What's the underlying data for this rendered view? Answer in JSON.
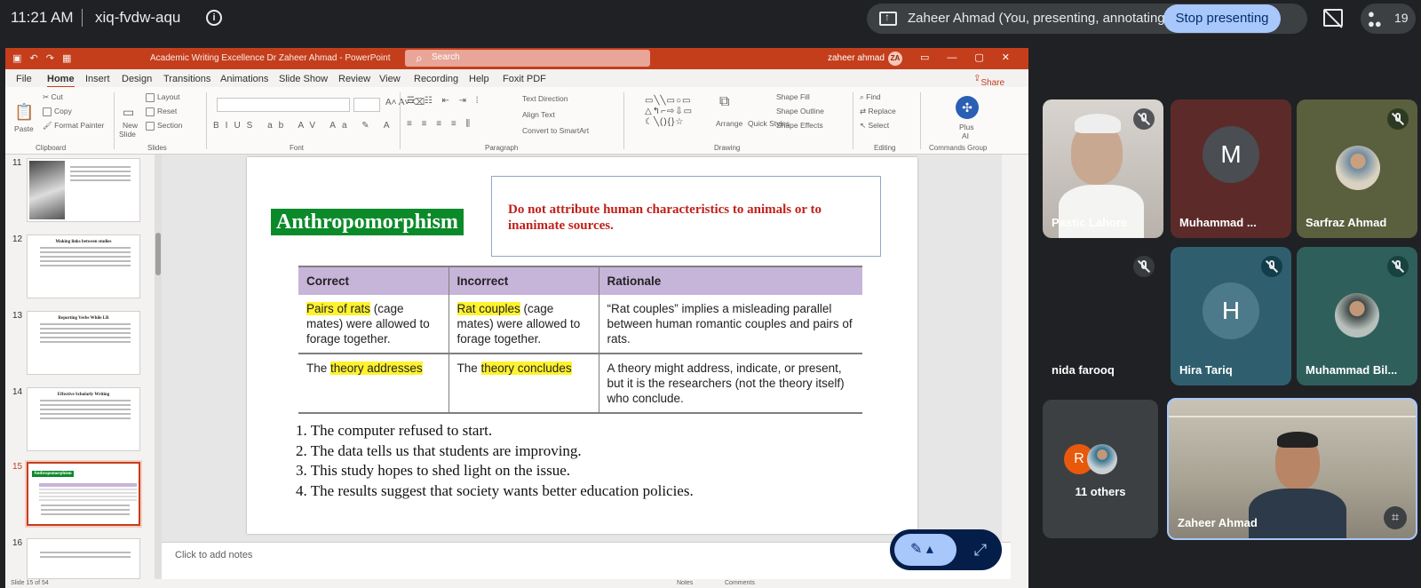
{
  "topbar": {
    "time": "11:21 AM",
    "meeting_code": "xiq-fvdw-aqu",
    "presenting_label": "Zaheer Ahmad (You, presenting, annotating)",
    "stop_presenting": "Stop presenting",
    "participant_count": "19"
  },
  "ppt": {
    "window_title": "Academic Writing Excellence Dr Zaheer Ahmad  -  PowerPoint",
    "search_placeholder": "Search",
    "user_name": "zaheer ahmad",
    "user_initials": "ZA",
    "menu": [
      "File",
      "Home",
      "Insert",
      "Design",
      "Transitions",
      "Animations",
      "Slide Show",
      "Review",
      "View",
      "Recording",
      "Help",
      "Foxit PDF"
    ],
    "share": "Share",
    "ribbon": {
      "clipboard": {
        "label": "Clipboard",
        "paste": "Paste",
        "cut": "Cut",
        "copy": "Copy",
        "format_painter": "Format Painter"
      },
      "slides": {
        "label": "Slides",
        "new_slide": "New",
        "slide": "Slide",
        "layout": "Layout",
        "reset": "Reset",
        "section": "Section"
      },
      "font": {
        "label": "Font"
      },
      "paragraph": {
        "label": "Paragraph",
        "text_direction": "Text Direction",
        "align_text": "Align Text",
        "convert": "Convert to SmartArt"
      },
      "drawing": {
        "label": "Drawing",
        "arrange": "Arrange",
        "quick_styles": "Quick Styles",
        "shape_fill": "Shape Fill",
        "shape_outline": "Shape Outline",
        "shape_effects": "Shape Effects"
      },
      "editing": {
        "label": "Editing",
        "find": "Find",
        "replace": "Replace",
        "select": "Select"
      },
      "commands": {
        "label": "Commands Group",
        "plus": "Plus",
        "ai": "AI"
      }
    },
    "thumbnails": [
      {
        "num": "11",
        "title": ""
      },
      {
        "num": "12",
        "title": "Making links between studies"
      },
      {
        "num": "13",
        "title": "Reporting Verbs While LR"
      },
      {
        "num": "14",
        "title": "Effective Scholarly Writing"
      },
      {
        "num": "15",
        "title": "Anthropomorphism"
      },
      {
        "num": "16",
        "title": ""
      }
    ],
    "notes_placeholder": "Click to add notes",
    "status": {
      "slide_count": "Slide 15 of 54",
      "notes": "Notes",
      "comments": "Comments"
    }
  },
  "slide": {
    "title": "Anthropomorphism",
    "warning": "Do not attribute human characteristics to animals or to inanimate sources.",
    "table": {
      "headers": [
        "Correct",
        "Incorrect",
        "Rationale"
      ],
      "rows": [
        {
          "correct_hl": "Pairs of rats",
          "correct_rest": " (cage mates) were allowed to forage together.",
          "incorrect_hl": "Rat couples",
          "incorrect_rest": " (cage mates) were allowed to forage together.",
          "rationale": "“Rat couples” implies a misleading parallel between human romantic couples and pairs of rats."
        },
        {
          "correct_pre": "The ",
          "correct_hl": "theory addresses",
          "incorrect_pre": "The ",
          "incorrect_hl": "theory concludes",
          "rationale": "A theory might address, indicate, or present, but it is the researchers (not the theory itself) who conclude."
        }
      ]
    },
    "list": [
      "1. The computer refused to start.",
      "2. The data tells us that students are improving.",
      "3. This study hopes to shed light on the issue.",
      "4. The results suggest that society wants better education policies."
    ]
  },
  "participants": [
    {
      "name": "Pastic Lahore",
      "type": "video"
    },
    {
      "name": "Muhammad ...",
      "initial": "M",
      "color": "#4a4d51"
    },
    {
      "name": "Sarfraz Ahmad",
      "type": "photo"
    },
    {
      "name": "nida farooq",
      "type": "none"
    },
    {
      "name": "Hira Tariq",
      "initial": "H",
      "color": "#4d7a8a"
    },
    {
      "name": "Muhammad Bil...",
      "type": "photo"
    },
    {
      "name": "11 others",
      "initial": "R",
      "color": "#e8590c"
    },
    {
      "name": "Zaheer Ahmad",
      "type": "video"
    }
  ],
  "colors": {
    "ppt_accent": "#c43e1c",
    "slide_title_bg": "#0b8a2a",
    "warning_text": "#c0201a",
    "table_header": "#c7b4d9",
    "highlight": "#fff22e",
    "meet_primary": "#a8c7fa",
    "meet_bg": "#202124"
  }
}
